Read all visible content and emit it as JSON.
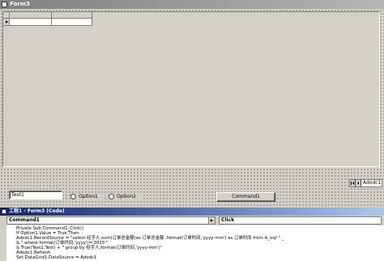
{
  "form_window": {
    "title": "Form3"
  },
  "adodc": {
    "caption": "Adodc1"
  },
  "text1": {
    "value": "Text1"
  },
  "options": [
    {
      "label": "Option1"
    },
    {
      "label": "Option2"
    }
  ],
  "command1": {
    "label": "Command1"
  },
  "code_window": {
    "title": "工程1 - Form3 (Code)",
    "object_combo": "Command1",
    "procedure_combo": "Click",
    "lines": [
      "Private Sub Command1_Click()",
      "If Option1.Value = True Then",
      "Adodc1.RecordSource = \"select 经手人,sum(订单总金额)as 订单总金额 ,format(订单时间,'yyyy-mm') as 订单时间 from A_xsjl \" _",
      "& \" where format(订单时间,'yyyy')='2015'\"",
      "& True(Text1.Text) + \" group by 经手人,format(订单时间,'yyyy-mm')\"",
      "Adodc1.Refresh",
      "Set DataGrid1.DataSource = Adodc1"
    ]
  },
  "colors": {
    "face": "#d4d0c8",
    "inactive_title": "#808080",
    "active_title": "#0a246a"
  }
}
